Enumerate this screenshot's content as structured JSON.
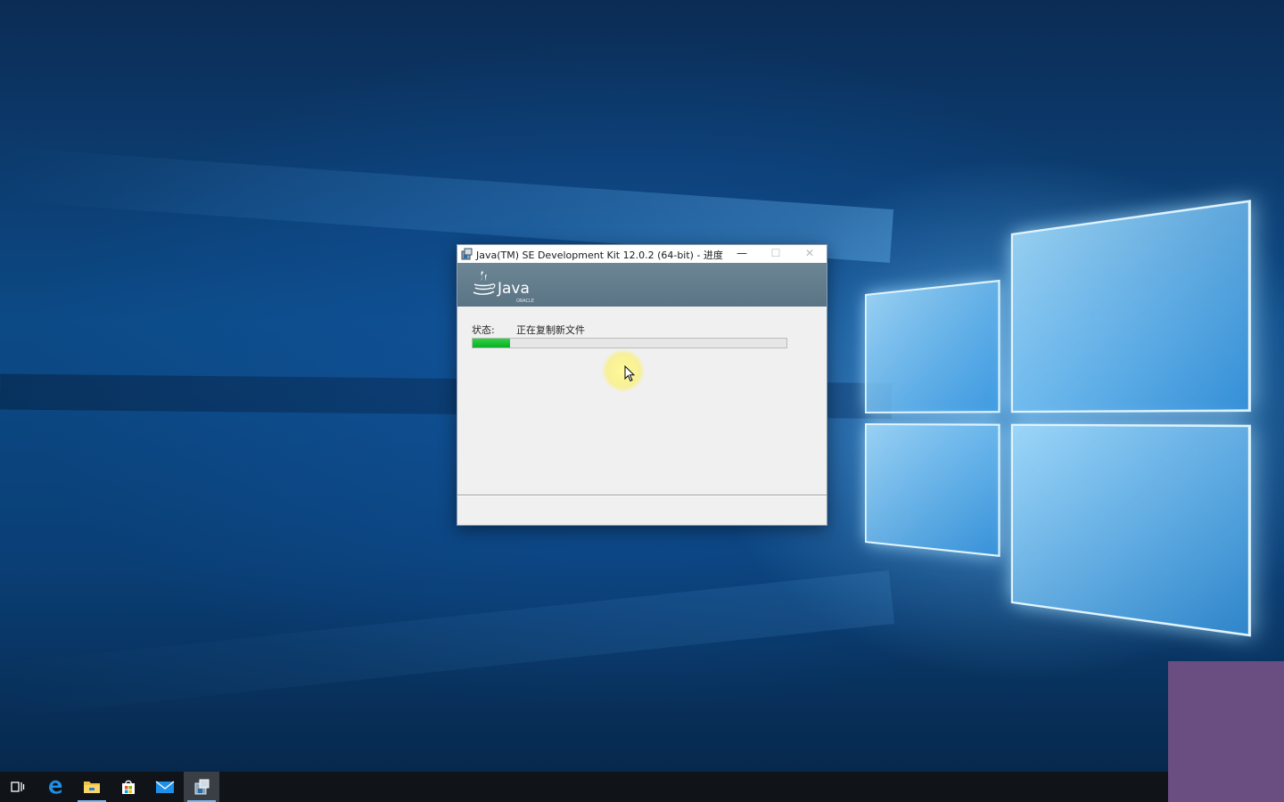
{
  "window": {
    "title": "Java(TM) SE Development Kit 12.0.2 (64-bit) - 进度",
    "minimize_glyph": "—",
    "maximize_glyph": "☐",
    "close_glyph": "✕",
    "banner_logo_text": "Java",
    "banner_logo_subtext": "ORACLE"
  },
  "status": {
    "label": "状态:",
    "text": "正在复制新文件"
  },
  "progress": {
    "percent": 12,
    "color": "#06b025"
  },
  "taskbar": {
    "items": [
      {
        "icon": "task-view-icon"
      },
      {
        "icon": "edge-icon"
      },
      {
        "icon": "file-explorer-icon"
      },
      {
        "icon": "store-icon"
      },
      {
        "icon": "mail-icon"
      },
      {
        "icon": "java-installer-icon",
        "active": true
      }
    ]
  },
  "colors": {
    "banner": "#5f7889",
    "taskbar": "#101418",
    "overlay": "#6a4e82",
    "desktop": "#0c4a86"
  }
}
